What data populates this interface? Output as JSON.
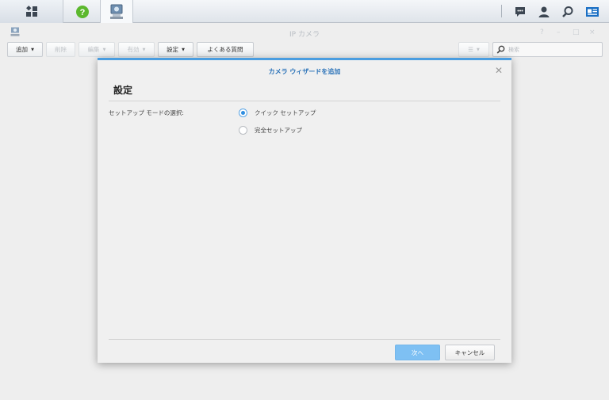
{
  "taskbar": {
    "main_icon": "grid-apps-icon",
    "help_icon": "help-icon",
    "ipcam_icon": "ip-camera-app-icon",
    "right_icons": [
      "chat-icon",
      "user-icon",
      "search-icon",
      "widgets-icon"
    ]
  },
  "window": {
    "title": "IP カメラ",
    "controls": [
      "?",
      "–",
      "□",
      "×"
    ]
  },
  "toolbar": {
    "add": "追加",
    "delete": "削除",
    "edit": "編集",
    "enable": "有効",
    "settings": "設定",
    "faq": "よくある質問",
    "list_view": "☰",
    "search_placeholder": "検索"
  },
  "dialog": {
    "title": "カメラ ウィザードを追加",
    "heading": "設定",
    "field_label": "セットアップ モードの選択:",
    "options": [
      {
        "label": "クイック セットアップ",
        "selected": true
      },
      {
        "label": "完全セットアップ",
        "selected": false
      }
    ],
    "next": "次へ",
    "cancel": "キャンセル"
  },
  "colors": {
    "accent": "#4a9de0",
    "title_blue": "#2a72b8",
    "next_button": "#7ec0f3"
  }
}
